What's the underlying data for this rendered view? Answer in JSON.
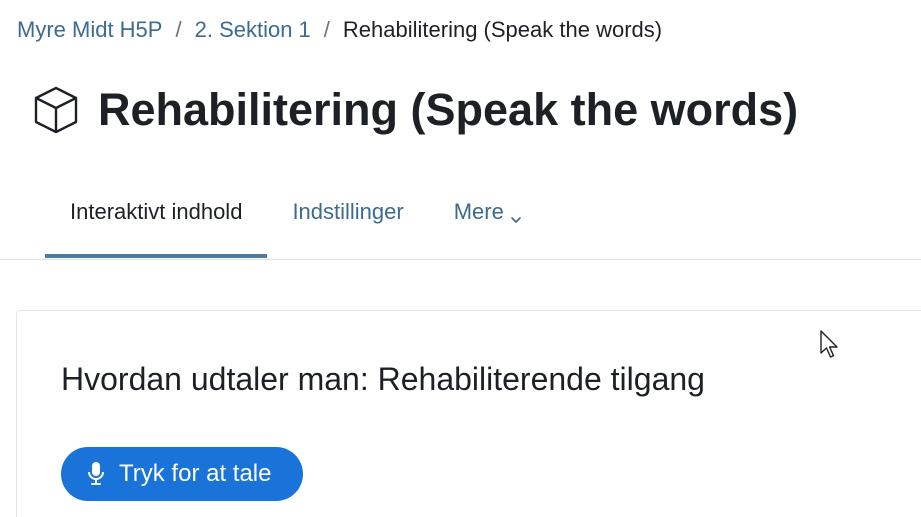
{
  "breadcrumb": {
    "items": [
      {
        "label": "Myre Midt H5P"
      },
      {
        "label": "2. Sektion 1"
      }
    ],
    "separator": "/",
    "current": "Rehabilitering (Speak the words)"
  },
  "header": {
    "icon": "cube-icon",
    "title": "Rehabilitering (Speak the words)"
  },
  "tabs": [
    {
      "label": "Interaktivt indhold",
      "active": true
    },
    {
      "label": "Indstillinger",
      "active": false
    },
    {
      "label": "Mere",
      "active": false,
      "icon": "chevron-down-icon"
    }
  ],
  "content": {
    "question": "Hvordan udtaler man: Rehabiliterende tilgang",
    "speak_button": {
      "label": "Tryk for at tale",
      "icon": "microphone-icon"
    }
  },
  "colors": {
    "link": "#3d6b8f",
    "text": "#1d2125",
    "active_tab_underline": "#4a7ba1",
    "button_bg": "#1a73d9"
  }
}
